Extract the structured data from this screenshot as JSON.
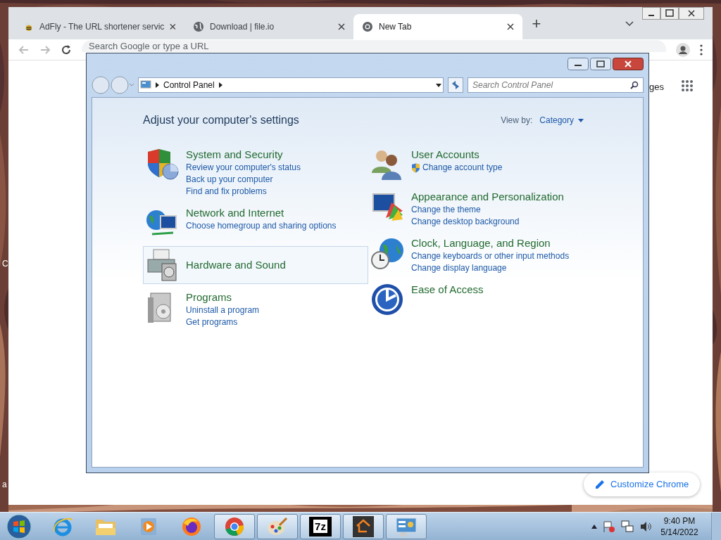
{
  "browser": {
    "tabs": [
      {
        "label": "AdFly - The URL shortener servic",
        "kind": "bee",
        "selected": false
      },
      {
        "label": "Download | file.io",
        "kind": "globe",
        "selected": false
      },
      {
        "label": "New Tab",
        "kind": "chrome",
        "selected": true
      }
    ],
    "new_tab": "+",
    "omnibox": {
      "placeholder": "Search Google or type a URL"
    },
    "page": {
      "partial_link": "ges",
      "customize_button": "Customize Chrome"
    }
  },
  "desktop_labels": [
    "C",
    "a"
  ],
  "control_panel": {
    "breadcrumb": "Control Panel",
    "search_placeholder": "Search Control Panel",
    "heading": "Adjust your computer's settings",
    "view_by_label": "View by:",
    "view_by_value": "Category",
    "columns": [
      [
        {
          "title": "System and Security",
          "kind": "security",
          "hovered": false,
          "links": [
            {
              "text": "Review your computer's status",
              "shield": false
            },
            {
              "text": "Back up your computer",
              "shield": false
            },
            {
              "text": "Find and fix problems",
              "shield": false
            }
          ]
        },
        {
          "title": "Network and Internet",
          "kind": "network",
          "hovered": false,
          "links": [
            {
              "text": "Choose homegroup and sharing options",
              "shield": false
            }
          ]
        },
        {
          "title": "Hardware and Sound",
          "kind": "hardware",
          "hovered": true
        },
        {
          "title": "Programs",
          "kind": "programs",
          "hovered": false,
          "links": [
            {
              "text": "Uninstall a program",
              "shield": false
            },
            {
              "text": "Get programs",
              "shield": false
            }
          ]
        }
      ],
      [
        {
          "title": "User Accounts",
          "kind": "users",
          "hovered": false,
          "links": [
            {
              "text": "Change account type",
              "shield": true
            }
          ]
        },
        {
          "title": "Appearance and Personalization",
          "kind": "appearance",
          "hovered": false,
          "links": [
            {
              "text": "Change the theme",
              "shield": false
            },
            {
              "text": "Change desktop background",
              "shield": false
            }
          ]
        },
        {
          "title": "Clock, Language, and Region",
          "kind": "clock",
          "hovered": false,
          "links": [
            {
              "text": "Change keyboards or other input methods",
              "shield": false
            },
            {
              "text": "Change display language",
              "shield": false
            }
          ]
        },
        {
          "title": "Ease of Access",
          "kind": "ease",
          "hovered": false
        }
      ]
    ]
  },
  "taskbar": {
    "items": [
      {
        "kind": "ie",
        "running": false
      },
      {
        "kind": "explorer",
        "running": false
      },
      {
        "kind": "media",
        "running": false
      },
      {
        "kind": "firefox",
        "running": false
      },
      {
        "kind": "chrome",
        "running": true
      },
      {
        "kind": "paint",
        "running": true
      },
      {
        "kind": "sevenzip",
        "label": "7z",
        "running": true
      },
      {
        "kind": "home",
        "running": true
      },
      {
        "kind": "controlpanel",
        "running": true
      }
    ],
    "clock": {
      "time": "9:40 PM",
      "date": "5/14/2022"
    }
  }
}
